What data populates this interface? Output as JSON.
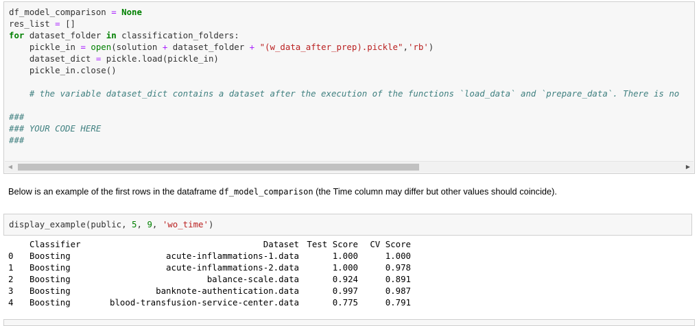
{
  "code_cell": {
    "lines": [
      "df_model_comparison = None",
      "res_list = []",
      "for dataset_folder in classification_folders:",
      "    pickle_in = open(solution + dataset_folder + \"(w_data_after_prep).pickle\",'rb')",
      "    dataset_dict = pickle.load(pickle_in)",
      "    pickle_in.close()",
      "",
      "    # the variable dataset_dict contains a dataset after the execution of the functions `load_data` and `prepare_data`. There is no",
      "",
      "###",
      "### YOUR CODE HERE",
      "###"
    ]
  },
  "markdown": {
    "before": "Below is an example of the first rows in the dataframe ",
    "code": "df_model_comparison",
    "after": " (the Time column may differ but other values should coincide)."
  },
  "code_cell2": {
    "line": "display_example(public, 5, 9, 'wo_time')"
  },
  "output_table": {
    "columns": [
      "",
      "Classifier",
      "Dataset",
      "Test Score",
      "CV Score"
    ],
    "rows": [
      [
        "0",
        "Boosting",
        "acute-inflammations-1.data",
        "1.000",
        "1.000"
      ],
      [
        "1",
        "Boosting",
        "acute-inflammations-2.data",
        "1.000",
        "0.978"
      ],
      [
        "2",
        "Boosting",
        "balance-scale.data",
        "0.924",
        "0.891"
      ],
      [
        "3",
        "Boosting",
        "banknote-authentication.data",
        "0.997",
        "0.987"
      ],
      [
        "4",
        "Boosting",
        "blood-transfusion-service-center.data",
        "0.775",
        "0.791"
      ]
    ]
  },
  "icons": {
    "scroll_left": "caret-left-icon",
    "scroll_right": "caret-right-icon"
  },
  "colors": {
    "keyword": "#008000",
    "operator": "#aa22ff",
    "string": "#ba2121",
    "comment": "#408080",
    "cell_background": "#f7f7f7"
  }
}
